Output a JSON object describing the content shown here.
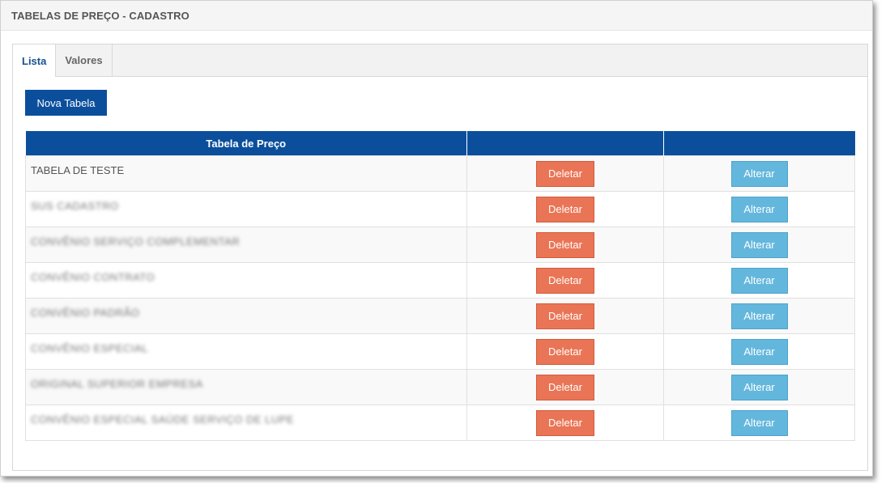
{
  "page": {
    "title": "TABELAS DE PREÇO - CADASTRO"
  },
  "tabs": [
    {
      "label": "Lista",
      "active": true
    },
    {
      "label": "Valores",
      "active": false
    }
  ],
  "toolbar": {
    "new_button_label": "Nova Tabela"
  },
  "table": {
    "columns": [
      "Tabela de Preço",
      "",
      ""
    ],
    "rows": [
      {
        "name": "TABELA DE TESTE",
        "delete_label": "Deletar",
        "edit_label": "Alterar"
      },
      {
        "name": "SUS CADASTRO",
        "delete_label": "Deletar",
        "edit_label": "Alterar"
      },
      {
        "name": "CONVÊNIO SERVIÇO COMPLEMENTAR",
        "delete_label": "Deletar",
        "edit_label": "Alterar"
      },
      {
        "name": "CONVÊNIO CONTRATO",
        "delete_label": "Deletar",
        "edit_label": "Alterar"
      },
      {
        "name": "CONVÊNIO PADRÃO",
        "delete_label": "Deletar",
        "edit_label": "Alterar"
      },
      {
        "name": "CONVÊNIO ESPECIAL",
        "delete_label": "Deletar",
        "edit_label": "Alterar"
      },
      {
        "name": "ORIGINAL SUPERIOR EMPRESA",
        "delete_label": "Deletar",
        "edit_label": "Alterar"
      },
      {
        "name": "CONVÊNIO ESPECIAL SAÚDE SERVIÇO DE LUPE",
        "delete_label": "Deletar",
        "edit_label": "Alterar"
      }
    ]
  },
  "colors": {
    "primary": "#0b4f9c",
    "delete": "#e97556",
    "edit": "#64b7dc",
    "tab_active_text": "#15508f"
  }
}
